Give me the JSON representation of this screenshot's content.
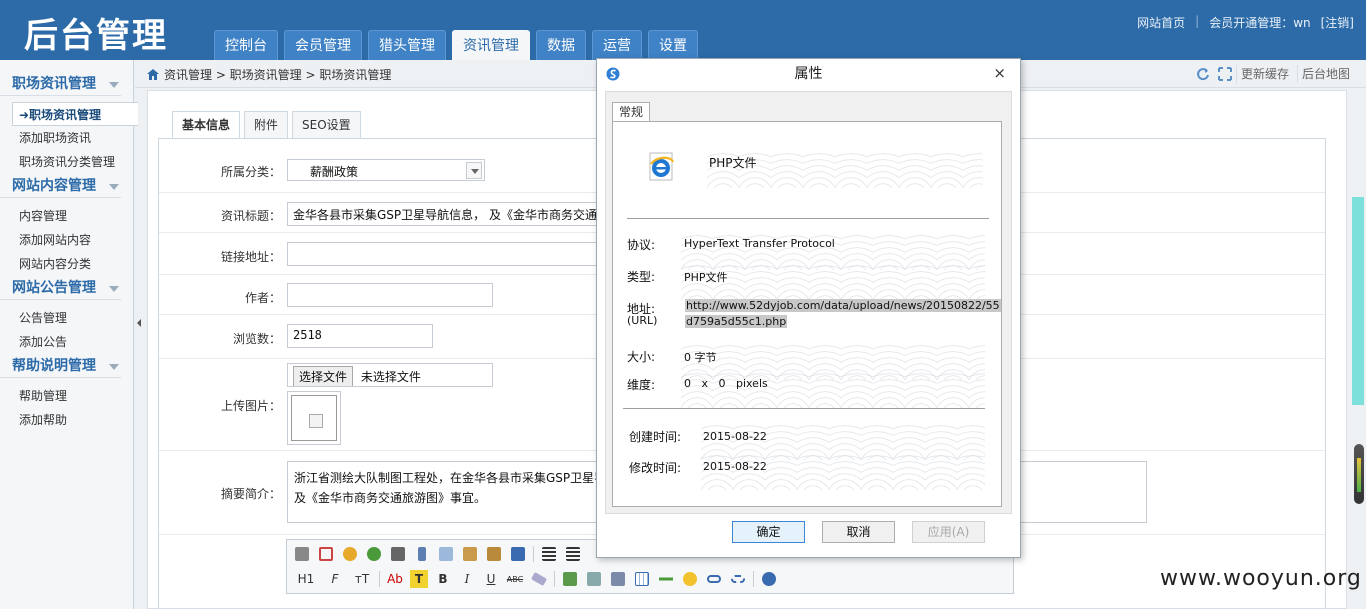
{
  "header": {
    "logo": "后台管理",
    "nav": [
      "控制台",
      "会员管理",
      "猎头管理",
      "资讯管理",
      "数据",
      "运营",
      "设置"
    ],
    "active_nav": "资讯管理",
    "links": {
      "home": "网站首页",
      "member": "会员开通管理：wn",
      "logout": "[注销]"
    }
  },
  "sidebar": {
    "groups": [
      {
        "title": "职场资讯管理",
        "items": [
          "➜职场资讯管理",
          "添加职场资讯",
          "职场资讯分类管理"
        ]
      },
      {
        "title": "网站内容管理",
        "items": [
          "内容管理",
          "添加网站内容",
          "网站内容分类"
        ]
      },
      {
        "title": "网站公告管理",
        "items": [
          "公告管理",
          "添加公告"
        ]
      },
      {
        "title": "帮助说明管理",
        "items": [
          "帮助管理",
          "添加帮助"
        ]
      }
    ]
  },
  "breadcrumb": "资讯管理 > 职场资讯管理 > 职场资讯管理",
  "tools": {
    "refresh_cache": "更新缓存",
    "sitemap": "后台地图"
  },
  "subtabs": [
    "基本信息",
    "附件",
    "SEO设置"
  ],
  "form": {
    "category_label": "所属分类：",
    "category_value": "薪酬政策",
    "title_label": "资讯标题：",
    "title_value": "金华各县市采集GSP卫星导航信息， 及《金华市商务交通",
    "link_label": "链接地址：",
    "author_label": "作者：",
    "views_label": "浏览数：",
    "views_value": "2518",
    "upload_label": "上传图片：",
    "file_button": "选择文件",
    "file_status": "未选择文件",
    "summary_label": "摘要简介：",
    "summary_text": "浙江省测绘大队制图工程处，在金华各县市采集GSP卫星导\n及《金华市商务交通旅游图》事宜。"
  },
  "editor": {
    "heading": "H1",
    "font": "F",
    "size": "тT",
    "color": "Ab",
    "bold": "B",
    "italic": "I",
    "underline": "U",
    "strike": "ABC"
  },
  "dialog": {
    "title": "属性",
    "close": "×",
    "tab": "常规",
    "file_type_name": "PHP文件",
    "protocol_label": "协议:",
    "protocol_value": "HyperText Transfer Protocol",
    "type_label": "类型:",
    "type_value": "PHP文件",
    "address_label": "地址:",
    "address_label2": "(URL)",
    "address_line1": "http://www.52dyjob.com/data/upload/news/20150822/55",
    "address_line2": "d759a5d55c1.php",
    "size_label": "大小:",
    "size_value": "0 字节",
    "dim_label": "维度:",
    "dim_value": "0   x   0   pixels",
    "created_label": "创建时间:",
    "created_value": "2015-08-22",
    "modified_label": "修改时间:",
    "modified_value": "2015-08-22",
    "ok": "确定",
    "cancel": "取消",
    "apply": "应用(A)"
  },
  "watermark": "www.wooyun.org",
  "colors": {
    "brand": "#2d6ba8",
    "accent_scroll": "#7ee0da"
  }
}
